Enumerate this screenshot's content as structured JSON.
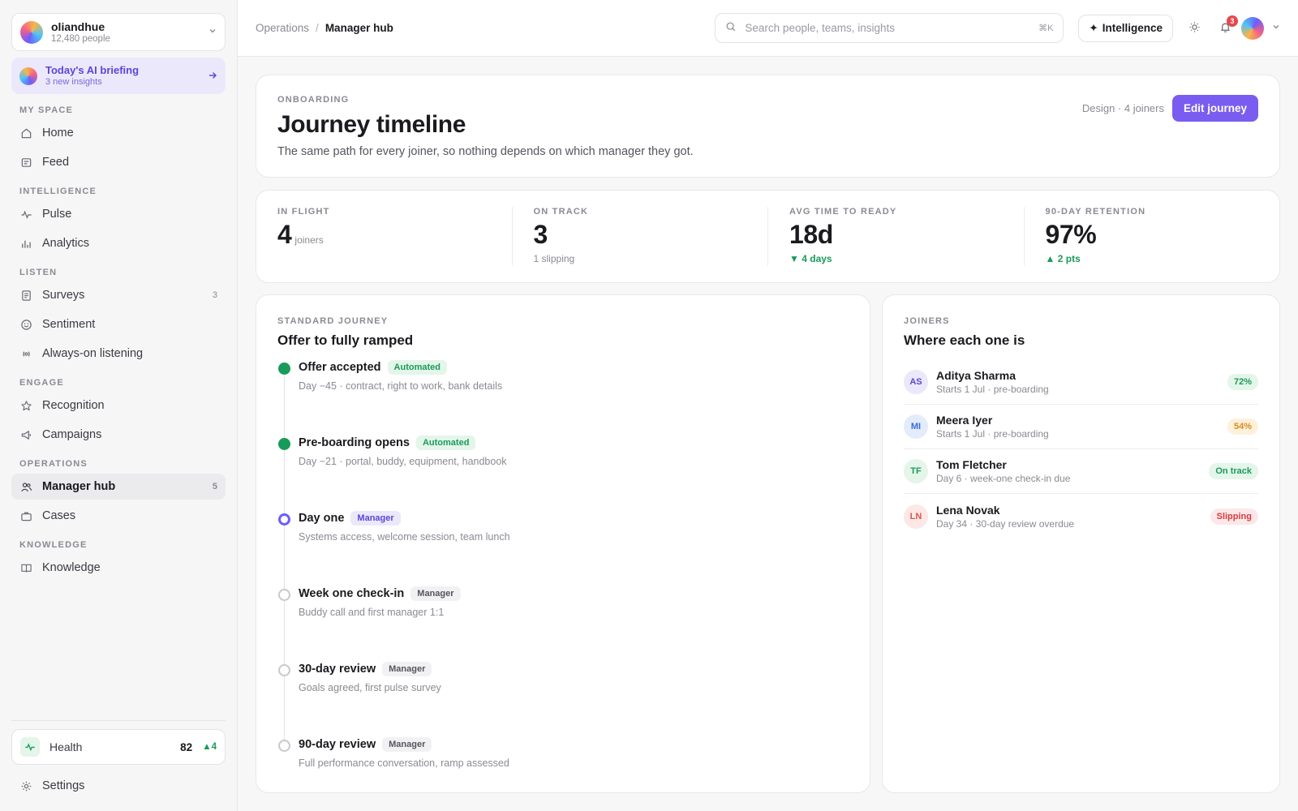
{
  "sidebar": {
    "org": {
      "name": "oliandhue",
      "sub": "12,480 people"
    },
    "briefing": {
      "title": "Today's AI briefing",
      "sub": "3 new insights"
    },
    "sections": {
      "myspace": "MY SPACE",
      "intelligence": "INTELLIGENCE",
      "listen": "LISTEN",
      "engage": "ENGAGE",
      "operations": "OPERATIONS",
      "knowledge": "KNOWLEDGE"
    },
    "items": {
      "home": "Home",
      "feed": "Feed",
      "pulse": "Pulse",
      "analytics": "Analytics",
      "surveys": "Surveys",
      "surveys_count": "3",
      "sentiment": "Sentiment",
      "listening": "Always-on listening",
      "recognition": "Recognition",
      "campaigns": "Campaigns",
      "managerhub": "Manager hub",
      "managerhub_count": "5",
      "cases": "Cases",
      "knowledge": "Knowledge"
    },
    "health": {
      "label": "Health",
      "value": "82",
      "delta": "4"
    },
    "settings": "Settings"
  },
  "topbar": {
    "crumb_parent": "Operations",
    "crumb_sep": "/",
    "crumb_current": "Manager hub",
    "search_placeholder": "Search people, teams, insights",
    "search_kbd": "⌘K",
    "intelligence_label": "Intelligence",
    "notifications_count": "3"
  },
  "header": {
    "eyebrow": "ONBOARDING",
    "title": "Journey timeline",
    "lead": "The same path for every joiner, so nothing depends on which manager they got.",
    "meta": "Design · 4 joiners",
    "edit_label": "Edit journey"
  },
  "stats": [
    {
      "label": "IN FLIGHT",
      "value": "4",
      "unit": "joiners",
      "sub": ""
    },
    {
      "label": "ON TRACK",
      "value": "3",
      "unit": "",
      "sub": "1 slipping"
    },
    {
      "label": "AVG TIME TO READY",
      "value": "18d",
      "unit": "",
      "sub": "4 days"
    },
    {
      "label": "90-DAY RETENTION",
      "value": "97%",
      "unit": "",
      "sub": "2 pts"
    }
  ],
  "journey": {
    "eyebrow": "STANDARD JOURNEY",
    "title": "Offer to fully ramped",
    "steps": [
      {
        "title": "Offer accepted",
        "tag": "Automated",
        "desc": "Day −45 · contract, right to work, bank details"
      },
      {
        "title": "Pre-boarding opens",
        "tag": "Automated",
        "desc": "Day −21 · portal, buddy, equipment, handbook"
      },
      {
        "title": "Day one",
        "tag": "Manager",
        "desc": "Systems access, welcome session, team lunch"
      },
      {
        "title": "Week one check-in",
        "tag": "Manager",
        "desc": "Buddy call and first manager 1:1"
      },
      {
        "title": "30-day review",
        "tag": "Manager",
        "desc": "Goals agreed, first pulse survey"
      },
      {
        "title": "90-day review",
        "tag": "Manager",
        "desc": "Full performance conversation, ramp assessed"
      }
    ]
  },
  "joiners": {
    "eyebrow": "JOINERS",
    "title": "Where each one is",
    "list": [
      {
        "initials": "AS",
        "name": "Aditya Sharma",
        "sub": "Starts 1 Jul · pre-boarding",
        "status": "72%"
      },
      {
        "initials": "MI",
        "name": "Meera Iyer",
        "sub": "Starts 1 Jul · pre-boarding",
        "status": "54%"
      },
      {
        "initials": "TF",
        "name": "Tom Fletcher",
        "sub": "Day 6 · week-one check-in due",
        "status": "On track"
      },
      {
        "initials": "LN",
        "name": "Lena Novak",
        "sub": "Day 34 · 30-day review overdue",
        "status": "Slipping"
      }
    ]
  },
  "colors": {
    "accent": "#7b5cf0",
    "success": "#1a9a5a",
    "warning": "#d98a1a",
    "danger": "#d93a3f"
  }
}
